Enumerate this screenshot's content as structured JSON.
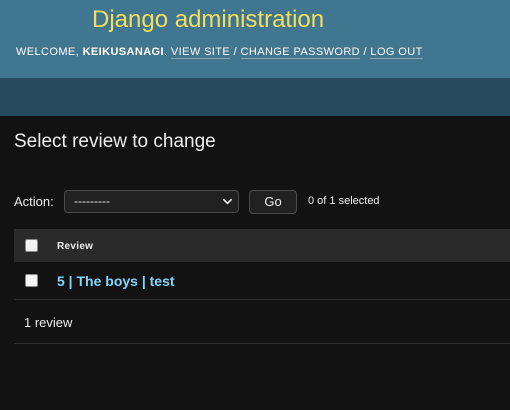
{
  "header": {
    "site_name": "Django administration",
    "welcome_prefix": "Welcome,",
    "username": "keikusanagi",
    "welcome_suffix": ".",
    "links": {
      "view_site": "View site",
      "change_password": "Change password",
      "log_out": "Log out"
    },
    "separator": "/"
  },
  "page": {
    "title": "Select review to change"
  },
  "actions": {
    "label": "Action:",
    "selected_value": "---------",
    "go_label": "Go",
    "counter": "0 of 1 selected"
  },
  "table": {
    "columns": [
      "Review"
    ],
    "rows": [
      {
        "review": "5 | The boys | test"
      }
    ]
  },
  "paginator": {
    "text": "1 review"
  },
  "colors": {
    "header_bg": "#417690",
    "breadcrumbs_bg": "#264b5d",
    "site_name": "#f5dd5d",
    "link": "#81d4fa",
    "body_bg": "#121212"
  }
}
